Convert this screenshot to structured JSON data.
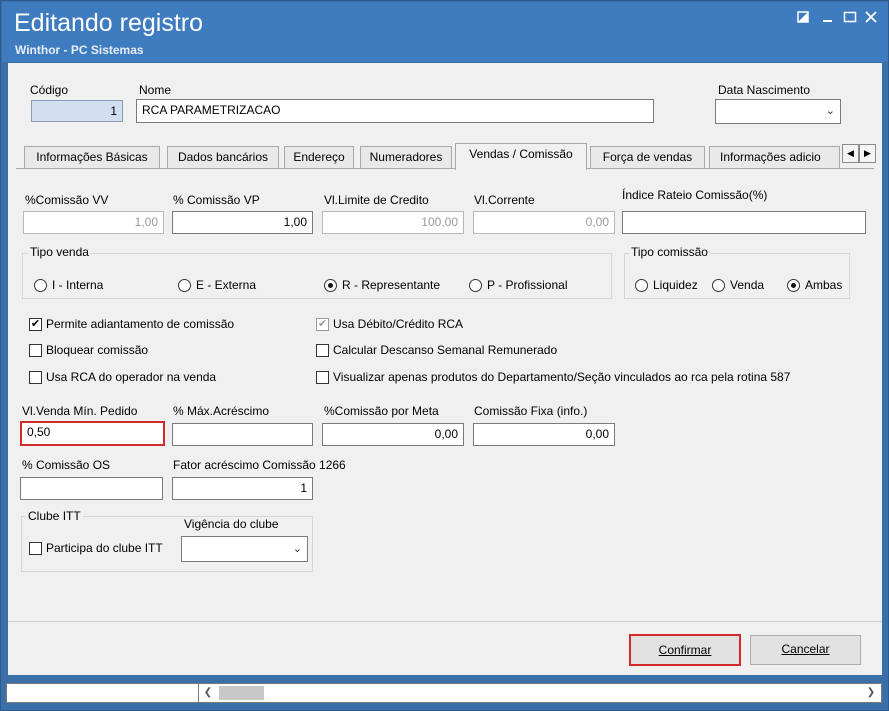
{
  "window": {
    "title": "Editando registro",
    "subtitle": "Winthor - PC Sistemas",
    "controls": [
      "restore-icon",
      "minimize-icon",
      "maximize-icon",
      "close-icon"
    ]
  },
  "header": {
    "codigo_label": "Código",
    "codigo_value": "1",
    "nome_label": "Nome",
    "nome_value": "RCA PARAMETRIZACAO",
    "nascimento_label": "Data Nascimento",
    "nascimento_value": ""
  },
  "tabs": [
    {
      "label": "Informações Básicas",
      "active": false
    },
    {
      "label": "Dados bancários",
      "active": false
    },
    {
      "label": "Endereço",
      "active": false
    },
    {
      "label": "Numeradores",
      "active": false
    },
    {
      "label": "Vendas  / Comissão",
      "active": true
    },
    {
      "label": "Força de vendas",
      "active": false
    },
    {
      "label": "Informações adicio",
      "active": false
    }
  ],
  "fields": {
    "comissao_vv_label": "%Comissão VV",
    "comissao_vv_value": "1,00",
    "comissao_vp_label": "% Comissão VP",
    "comissao_vp_value": "1,00",
    "limite_credito_label": "Vl.Limite de Credito",
    "limite_credito_value": "100,00",
    "vl_corrente_label": "Vl.Corrente",
    "vl_corrente_value": "0,00",
    "indice_rateio_label": "Índice Rateio Comissão(%)",
    "indice_rateio_value": ""
  },
  "tipo_venda": {
    "title": "Tipo venda",
    "options": [
      {
        "label": "I - Interna",
        "selected": false
      },
      {
        "label": "E - Externa",
        "selected": false
      },
      {
        "label": "R - Representante",
        "selected": true
      },
      {
        "label": "P - Profissional",
        "selected": false
      }
    ]
  },
  "tipo_comissao": {
    "title": "Tipo comissão",
    "options": [
      {
        "label": "Liquidez",
        "selected": false
      },
      {
        "label": "Venda",
        "selected": false
      },
      {
        "label": "Ambas",
        "selected": true
      }
    ]
  },
  "checks": [
    {
      "label": "Permite adiantamento de comissão",
      "checked": true,
      "enabled": true
    },
    {
      "label": "Usa Débito/Crédito RCA",
      "checked": true,
      "enabled": false
    },
    {
      "label": "Bloquear comissão",
      "checked": false,
      "enabled": true
    },
    {
      "label": "Calcular Descanso Semanal Remunerado",
      "checked": false,
      "enabled": true
    },
    {
      "label": "Usa RCA do operador na venda",
      "checked": false,
      "enabled": true
    },
    {
      "label": "Visualizar apenas produtos do Departamento/Seção vinculados ao rca pela rotina 587",
      "checked": false,
      "enabled": true
    }
  ],
  "fields2": {
    "venda_min_label": "Vl.Venda Mín. Pedido",
    "venda_min_value": "0,50",
    "max_acrescimo_label": "% Máx.Acréscimo",
    "max_acrescimo_value": "",
    "comissao_meta_label": "%Comissão por Meta",
    "comissao_meta_value": "0,00",
    "comissao_fixa_label": "Comissão Fixa (info.)",
    "comissao_fixa_value": "0,00",
    "comissao_os_label": "% Comissão OS",
    "comissao_os_value": "",
    "fator_label": "Fator acréscimo Comissão 1266",
    "fator_value": "1"
  },
  "clube": {
    "title": "Clube ITT",
    "participa_label": "Participa do clube ITT",
    "vigencia_label": "Vigência do clube",
    "vigencia_value": ""
  },
  "buttons": {
    "confirmar": "Confirmar",
    "cancelar": "Cancelar"
  },
  "colors": {
    "titlebar": "#3f7cbf",
    "highlight": "#d32b2b"
  }
}
